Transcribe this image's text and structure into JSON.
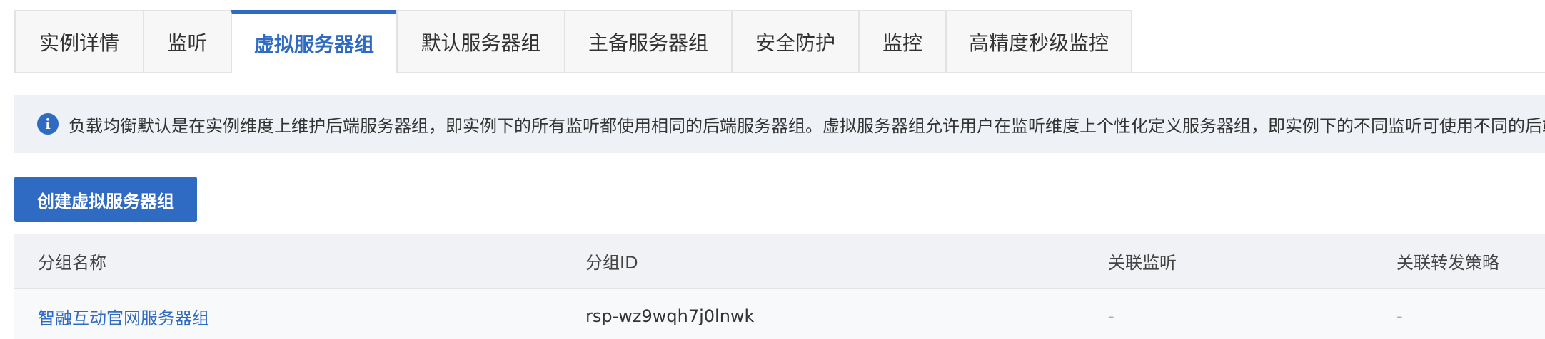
{
  "tabs": [
    {
      "label": "实例详情"
    },
    {
      "label": "监听"
    },
    {
      "label": "虚拟服务器组"
    },
    {
      "label": "默认服务器组"
    },
    {
      "label": "主备服务器组"
    },
    {
      "label": "安全防护"
    },
    {
      "label": "监控"
    },
    {
      "label": "高精度秒级监控"
    }
  ],
  "active_tab": "虚拟服务器组",
  "notice": {
    "icon": "info-icon",
    "text": "负载均衡默认是在实例维度上维护后端服务器组，即实例下的所有监听都使用相同的后端服务器组。虚拟服务器组允许用户在监听维度上个性化定义服务器组，即实例下的不同监听可使用不同的后端"
  },
  "create_button": {
    "label": "创建虚拟服务器组"
  },
  "table": {
    "headers": [
      "分组名称",
      "分组ID",
      "关联监听",
      "关联转发策略"
    ],
    "rows": [
      {
        "name": "智融互动官网服务器组",
        "id": "rsp-wz9wqh7j0lnwk",
        "listener": "-",
        "policy": "-"
      }
    ]
  },
  "colors": {
    "accent": "#2f6ac3",
    "notice_bg": "#eef1f6",
    "header_bg": "#f0f2f5"
  }
}
